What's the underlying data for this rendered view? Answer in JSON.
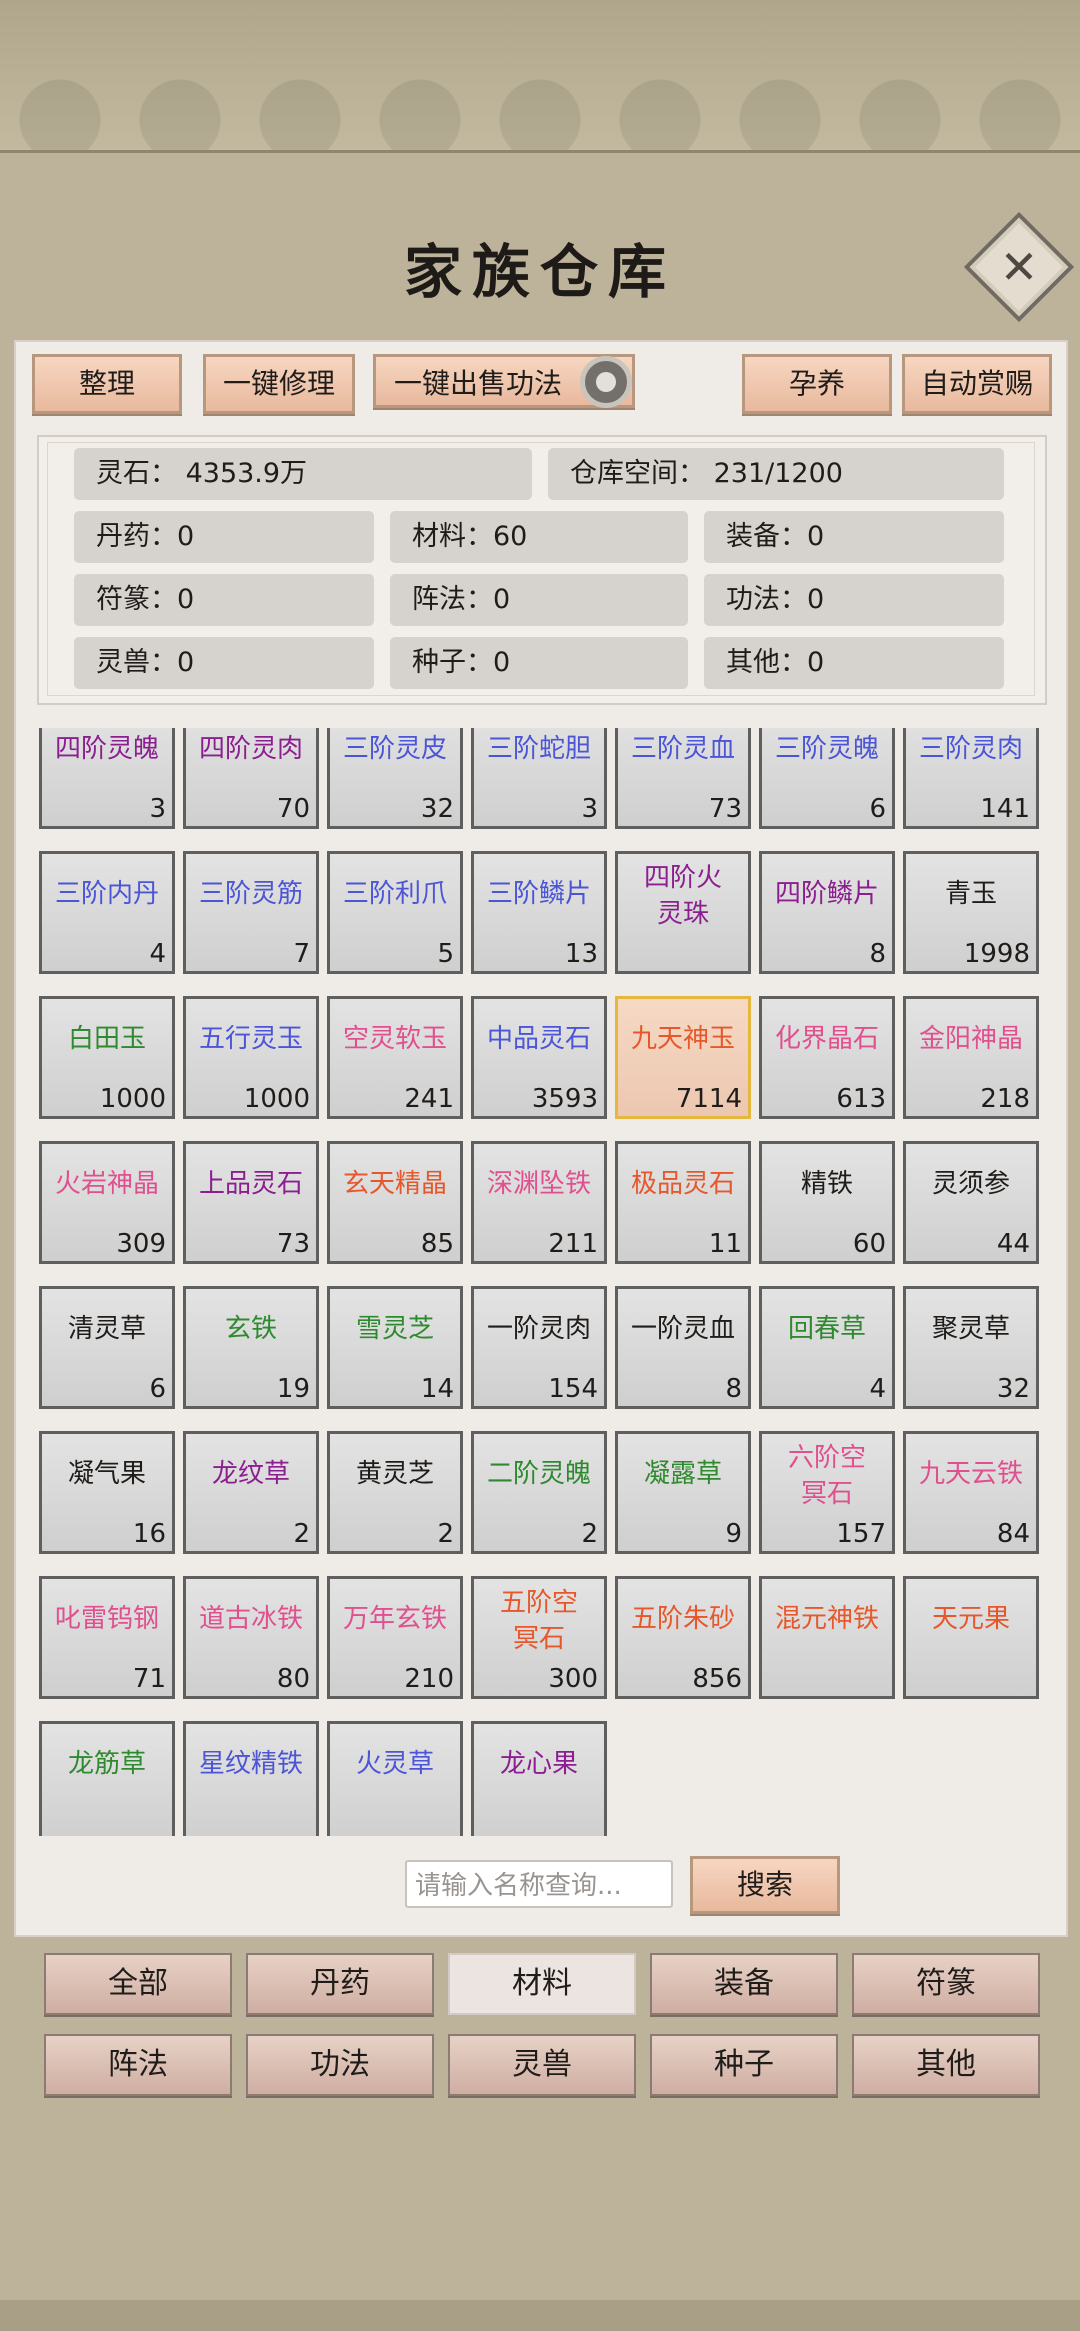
{
  "title": "家族仓库",
  "toolbar": {
    "organize": "整理",
    "repair_all": "一键修理",
    "sell_all": "一键出售功法",
    "breed": "孕养",
    "auto_reward": "自动赏赐"
  },
  "stats": {
    "spirit_stone": "灵石：  4353.9万",
    "storage": "仓库空间：   231/1200",
    "pills": "丹药：0",
    "materials": "材料：60",
    "equipment": "装备：0",
    "talismans": "符篆：0",
    "formations": "阵法：0",
    "techniques": "功法：0",
    "beasts": "灵兽：0",
    "seeds": "种子：0",
    "others": "其他：0"
  },
  "colors": {
    "green": "#2f8a2f",
    "blue": "#4b55d6",
    "purple": "#8b1f8f",
    "pink": "#e0508f",
    "orange": "#e6582b",
    "black": "#1f1c19"
  },
  "items": [
    {
      "name": "四阶灵魄",
      "count": "3",
      "color": "purple"
    },
    {
      "name": "四阶灵肉",
      "count": "70",
      "color": "purple"
    },
    {
      "name": "三阶灵皮",
      "count": "32",
      "color": "blue"
    },
    {
      "name": "三阶蛇胆",
      "count": "3",
      "color": "blue"
    },
    {
      "name": "三阶灵血",
      "count": "73",
      "color": "blue"
    },
    {
      "name": "三阶灵魄",
      "count": "6",
      "color": "blue"
    },
    {
      "name": "三阶灵肉",
      "count": "141",
      "color": "blue"
    },
    {
      "name": "三阶内丹",
      "count": "4",
      "color": "blue"
    },
    {
      "name": "三阶灵筋",
      "count": "7",
      "color": "blue"
    },
    {
      "name": "三阶利爪",
      "count": "5",
      "color": "blue"
    },
    {
      "name": "三阶鳞片",
      "count": "13",
      "color": "blue"
    },
    {
      "name": "四阶火灵珠",
      "count": "",
      "color": "purple"
    },
    {
      "name": "四阶鳞片",
      "count": "8",
      "color": "purple"
    },
    {
      "name": "青玉",
      "count": "1998",
      "color": "black"
    },
    {
      "name": "白田玉",
      "count": "1000",
      "color": "green"
    },
    {
      "name": "五行灵玉",
      "count": "1000",
      "color": "blue"
    },
    {
      "name": "空灵软玉",
      "count": "241",
      "color": "pink"
    },
    {
      "name": "中品灵石",
      "count": "3593",
      "color": "blue"
    },
    {
      "name": "九天神玉",
      "count": "7114",
      "color": "orange",
      "selected": true
    },
    {
      "name": "化界晶石",
      "count": "613",
      "color": "pink"
    },
    {
      "name": "金阳神晶",
      "count": "218",
      "color": "pink"
    },
    {
      "name": "火岩神晶",
      "count": "309",
      "color": "pink"
    },
    {
      "name": "上品灵石",
      "count": "73",
      "color": "purple"
    },
    {
      "name": "玄天精晶",
      "count": "85",
      "color": "orange"
    },
    {
      "name": "深渊坠铁",
      "count": "211",
      "color": "pink"
    },
    {
      "name": "极品灵石",
      "count": "11",
      "color": "orange"
    },
    {
      "name": "精铁",
      "count": "60",
      "color": "black"
    },
    {
      "name": "灵须参",
      "count": "44",
      "color": "black"
    },
    {
      "name": "清灵草",
      "count": "6",
      "color": "black"
    },
    {
      "name": "玄铁",
      "count": "19",
      "color": "green"
    },
    {
      "name": "雪灵芝",
      "count": "14",
      "color": "green"
    },
    {
      "name": "一阶灵肉",
      "count": "154",
      "color": "black"
    },
    {
      "name": "一阶灵血",
      "count": "8",
      "color": "black"
    },
    {
      "name": "回春草",
      "count": "4",
      "color": "green"
    },
    {
      "name": "聚灵草",
      "count": "32",
      "color": "black"
    },
    {
      "name": "凝气果",
      "count": "16",
      "color": "black"
    },
    {
      "name": "龙纹草",
      "count": "2",
      "color": "purple"
    },
    {
      "name": "黄灵芝",
      "count": "2",
      "color": "black"
    },
    {
      "name": "二阶灵魄",
      "count": "2",
      "color": "green"
    },
    {
      "name": "凝露草",
      "count": "9",
      "color": "green"
    },
    {
      "name": "六阶空冥石",
      "count": "157",
      "color": "pink"
    },
    {
      "name": "九天云铁",
      "count": "84",
      "color": "pink"
    },
    {
      "name": "叱雷钨钢",
      "count": "71",
      "color": "pink"
    },
    {
      "name": "道古冰铁",
      "count": "80",
      "color": "pink"
    },
    {
      "name": "万年玄铁",
      "count": "210",
      "color": "pink"
    },
    {
      "name": "五阶空冥石",
      "count": "300",
      "color": "orange"
    },
    {
      "name": "五阶朱砂",
      "count": "856",
      "color": "orange"
    },
    {
      "name": "混元神铁",
      "count": "",
      "color": "orange"
    },
    {
      "name": "天元果",
      "count": "",
      "color": "orange"
    },
    {
      "name": "龙筋草",
      "count": "",
      "color": "green"
    },
    {
      "name": "星纹精铁",
      "count": "",
      "color": "blue"
    },
    {
      "name": "火灵草",
      "count": "",
      "color": "blue"
    },
    {
      "name": "龙心果",
      "count": "",
      "color": "purple"
    }
  ],
  "search": {
    "placeholder": "请输入名称查询...",
    "button": "搜索"
  },
  "tabs": [
    {
      "label": "全部"
    },
    {
      "label": "丹药"
    },
    {
      "label": "材料",
      "active": true
    },
    {
      "label": "装备"
    },
    {
      "label": "符篆"
    },
    {
      "label": "阵法"
    },
    {
      "label": "功法"
    },
    {
      "label": "灵兽"
    },
    {
      "label": "种子"
    },
    {
      "label": "其他"
    }
  ]
}
